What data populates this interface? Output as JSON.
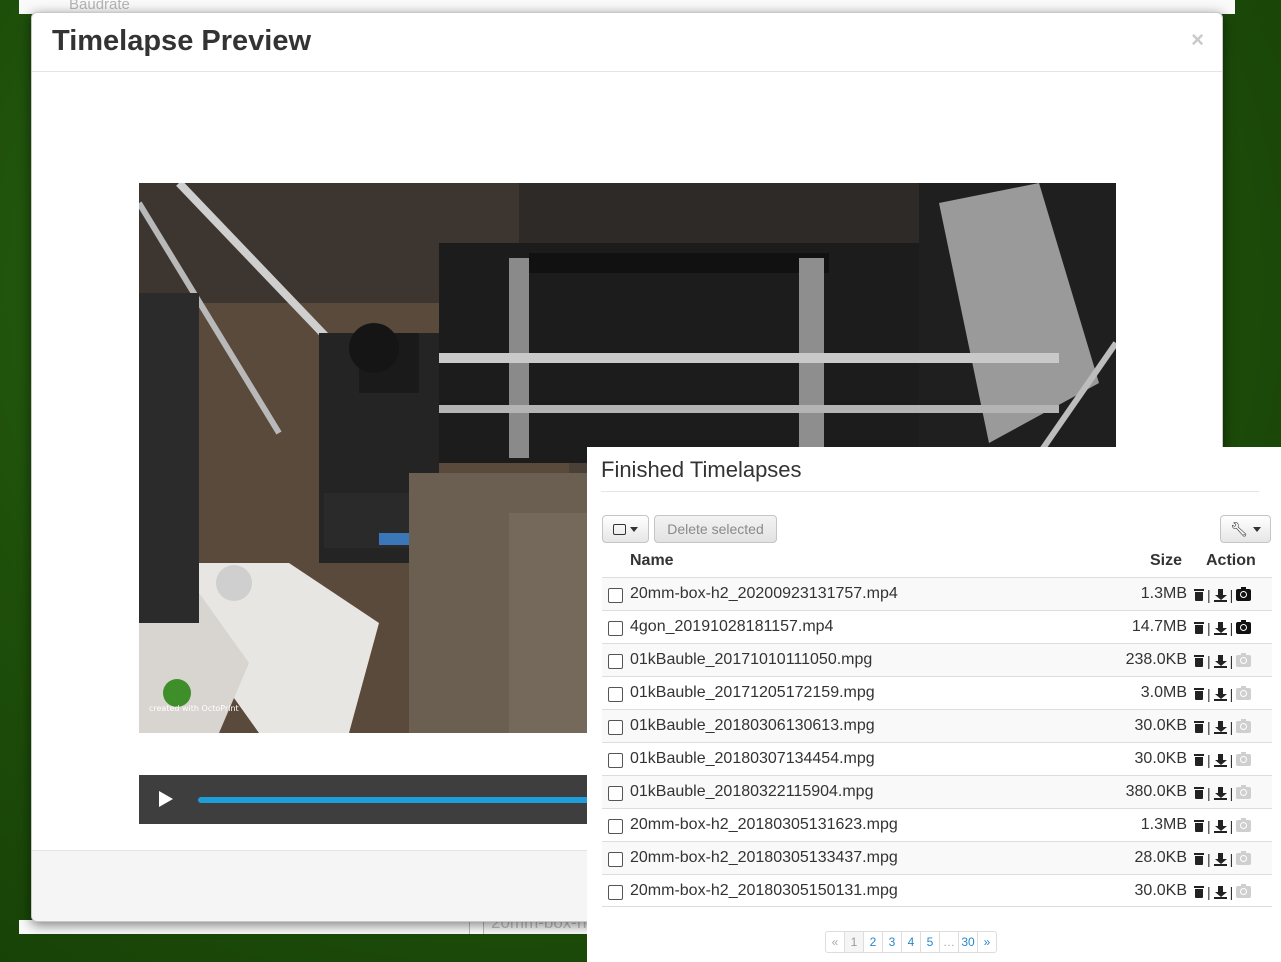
{
  "background": {
    "top_text": "Baudrate",
    "lower_text": "20mm-box-h"
  },
  "modal": {
    "title": "Timelapse Preview",
    "close": "×"
  },
  "video": {
    "watermark": "created with OctoPrint",
    "progress_fraction": 1.0
  },
  "timelapses": {
    "title": "Finished Timelapses",
    "delete_label": "Delete selected",
    "col_name": "Name",
    "col_size": "Size",
    "col_action": "Action",
    "rows": [
      {
        "name": "20mm-box-h2_20200923131757.mp4",
        "size": "1.3MB",
        "snapshot": true
      },
      {
        "name": "4gon_20191028181157.mp4",
        "size": "14.7MB",
        "snapshot": true
      },
      {
        "name": "01kBauble_20171010111050.mpg",
        "size": "238.0KB",
        "snapshot": false
      },
      {
        "name": "01kBauble_20171205172159.mpg",
        "size": "3.0MB",
        "snapshot": false
      },
      {
        "name": "01kBauble_20180306130613.mpg",
        "size": "30.0KB",
        "snapshot": false
      },
      {
        "name": "01kBauble_20180307134454.mpg",
        "size": "30.0KB",
        "snapshot": false
      },
      {
        "name": "01kBauble_20180322115904.mpg",
        "size": "380.0KB",
        "snapshot": false
      },
      {
        "name": "20mm-box-h2_20180305131623.mpg",
        "size": "1.3MB",
        "snapshot": false
      },
      {
        "name": "20mm-box-h2_20180305133437.mpg",
        "size": "28.0KB",
        "snapshot": false
      },
      {
        "name": "20mm-box-h2_20180305150131.mpg",
        "size": "30.0KB",
        "snapshot": false
      }
    ],
    "pagination": {
      "prev": "«",
      "pages": [
        "1",
        "2",
        "3",
        "4",
        "5",
        "…",
        "30"
      ],
      "next": "»",
      "current": "1"
    }
  },
  "icons": {
    "delete": "trash-icon",
    "download": "download-icon",
    "snapshot": "camera-icon",
    "settings": "wrench-icon",
    "play": "play-icon"
  },
  "colors": {
    "progress": "#1e9ed9",
    "link": "#2a88c9",
    "background_green": "#1e4f0a"
  }
}
